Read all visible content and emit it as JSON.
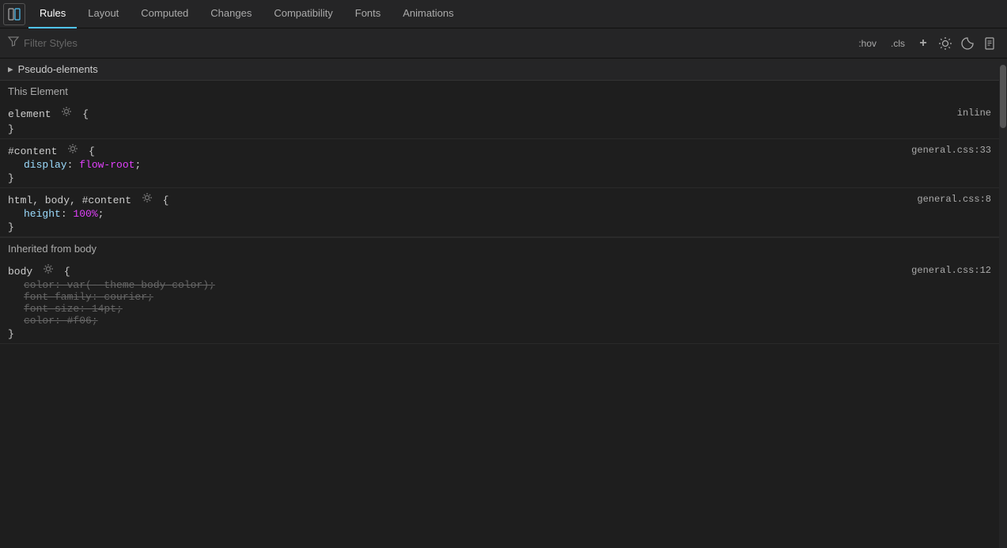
{
  "tabs": [
    {
      "id": "rules",
      "label": "Rules",
      "active": true
    },
    {
      "id": "layout",
      "label": "Layout",
      "active": false
    },
    {
      "id": "computed",
      "label": "Computed",
      "active": false
    },
    {
      "id": "changes",
      "label": "Changes",
      "active": false
    },
    {
      "id": "compatibility",
      "label": "Compatibility",
      "active": false
    },
    {
      "id": "fonts",
      "label": "Fonts",
      "active": false
    },
    {
      "id": "animations",
      "label": "Animations",
      "active": false
    }
  ],
  "filter": {
    "placeholder": "Filter Styles",
    "hov_label": ":hov",
    "cls_label": ".cls"
  },
  "pseudo_elements": {
    "label": "Pseudo-elements",
    "expanded": false
  },
  "this_element": {
    "label": "This Element"
  },
  "rules": [
    {
      "id": "element-rule",
      "selector": "element {",
      "gear": true,
      "source": "inline",
      "properties": [],
      "close": "}"
    },
    {
      "id": "content-rule",
      "selector": "#content",
      "gear": true,
      "open": "{",
      "source": "general.css:33",
      "properties": [
        {
          "name": "display",
          "value": "flow-root",
          "pink": true,
          "struck": false
        }
      ],
      "close": "}"
    },
    {
      "id": "html-body-rule",
      "selector": "html, body, #content",
      "gear": true,
      "open": "{",
      "source": "general.css:8",
      "properties": [
        {
          "name": "height",
          "value": "100%",
          "pink": true,
          "struck": false
        }
      ],
      "close": "}"
    }
  ],
  "inherited": {
    "label": "Inherited from body"
  },
  "body_rule": {
    "selector": "body",
    "gear": true,
    "open": "{",
    "source": "general.css:12",
    "properties": [
      {
        "name": "color",
        "value": "var(--theme-body-color);",
        "pink": false,
        "struck": true
      },
      {
        "name": "font-family",
        "value": "courier;",
        "pink": false,
        "struck": true
      },
      {
        "name": "font-size",
        "value": "14pt;",
        "pink": false,
        "struck": true
      },
      {
        "name": "color",
        "value": "#f06;",
        "pink": false,
        "struck": true
      }
    ],
    "close": "}"
  },
  "icons": {
    "panel_toggle": "▦",
    "filter_funnel": "⊿",
    "add": "+",
    "light_theme": "☀",
    "dark_theme": "◑",
    "document": "📄",
    "triangle_right": "▶",
    "gear": "⚙"
  }
}
